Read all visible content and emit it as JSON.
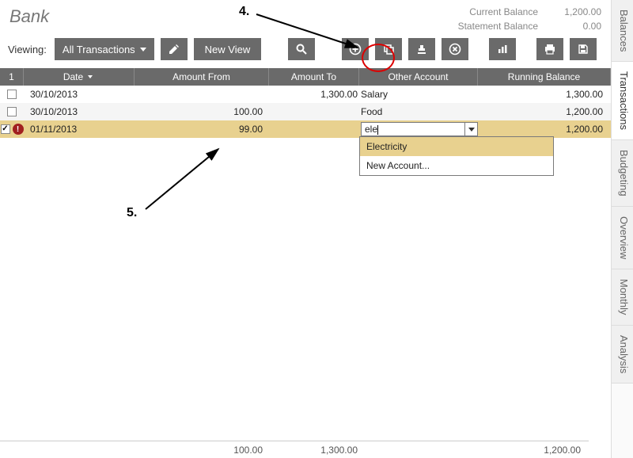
{
  "title": "Bank",
  "balances": {
    "current": {
      "label": "Current Balance",
      "value": "1,200.00"
    },
    "statement": {
      "label": "Statement Balance",
      "value": "0.00"
    }
  },
  "toolbar": {
    "viewing_label": "Viewing:",
    "view_dropdown": "All Transactions",
    "new_view": "New View"
  },
  "columns": {
    "num": "1",
    "date": "Date",
    "amount_from": "Amount From",
    "amount_to": "Amount To",
    "other_account": "Other Account",
    "running_balance": "Running Balance"
  },
  "rows": [
    {
      "checked": false,
      "alert": false,
      "date": "30/10/2013",
      "amount_from": "",
      "amount_to": "1,300.00",
      "other_account": "Salary",
      "running_balance": "1,300.00",
      "highlight": false
    },
    {
      "checked": false,
      "alert": false,
      "date": "30/10/2013",
      "amount_from": "100.00",
      "amount_to": "",
      "other_account": "Food",
      "running_balance": "1,200.00",
      "highlight": false
    },
    {
      "checked": true,
      "alert": true,
      "date": "01/11/2013",
      "amount_from": "99.00",
      "amount_to": "",
      "other_account_input": "ele",
      "running_balance": "1,200.00",
      "highlight": true
    }
  ],
  "dropdown": {
    "options": [
      "Electricity",
      "New Account..."
    ],
    "highlighted_index": 0
  },
  "footer": {
    "amount_from": "100.00",
    "amount_to": "1,300.00",
    "running_balance": "1,200.00"
  },
  "sidetabs": [
    "Balances",
    "Transactions",
    "Budgeting",
    "Overview",
    "Monthly",
    "Analysis"
  ],
  "sidetab_active_index": 1,
  "annotations": {
    "label4": "4.",
    "label5": "5."
  }
}
